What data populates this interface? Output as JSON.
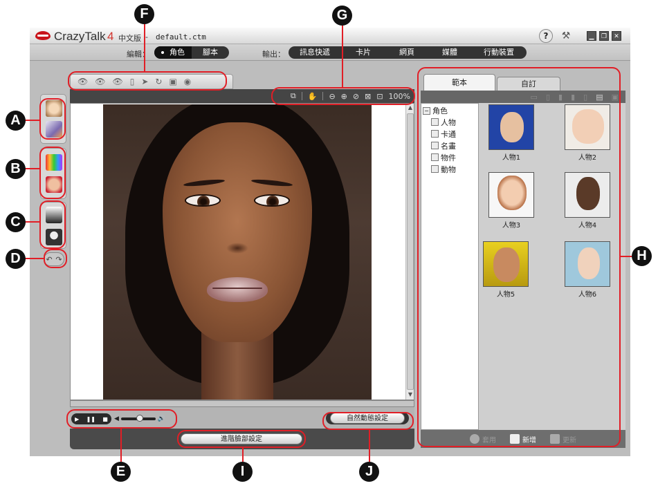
{
  "titlebar": {
    "app_name": "CrazyTalk",
    "version": "4",
    "edition": "中文版",
    "separator": " - ",
    "file_name": "default.ctm",
    "help_label": "?",
    "minimize_label": "▁",
    "restore_label": "❐",
    "close_label": "✕"
  },
  "menubar": {
    "edit_label": "編輯：",
    "output_label": "輸出：",
    "edit_modes": [
      "角色",
      "腳本"
    ],
    "output_modes": [
      "訊息快遞",
      "卡片",
      "網頁",
      "媒體",
      "行動裝置"
    ]
  },
  "viewer": {
    "zoom_level": "100%",
    "volume_level": 0.55
  },
  "buttons": {
    "advanced_face_settings": "進階臉部設定",
    "auto_motion_settings": "自然動態設定"
  },
  "library": {
    "tabs": [
      "範本",
      "自訂"
    ],
    "tree_root": "角色",
    "tree_items": [
      "人物",
      "卡通",
      "名畫",
      "物件",
      "動物"
    ],
    "thumbnails": [
      "人物1",
      "人物2",
      "人物3",
      "人物4",
      "人物5",
      "人物6"
    ],
    "bottom": {
      "apply_label": "套用",
      "add_label": "新增",
      "update_label": "更新"
    }
  },
  "callouts": [
    "A",
    "B",
    "C",
    "D",
    "E",
    "F",
    "G",
    "H",
    "I",
    "J"
  ],
  "colors": {
    "annotation_red": "#e11e26",
    "callout_black": "#111111",
    "logo_red": "#c8141a"
  }
}
